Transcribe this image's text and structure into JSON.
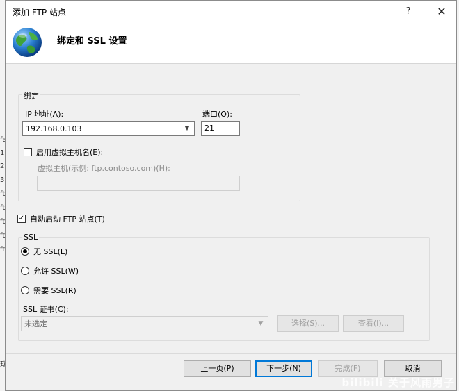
{
  "background": {
    "left_fragments": [
      "fa",
      "1",
      "2",
      "3",
      "ft",
      "ft",
      "ft",
      "ft",
      "ft",
      "现"
    ]
  },
  "dialog": {
    "title": "添加 FTP 站点",
    "help_glyph": "?",
    "close_glyph": "✕",
    "header_title": "绑定和 SSL 设置"
  },
  "binding": {
    "group_label": "绑定",
    "ip_label": "IP 地址(A):",
    "ip_value": "192.168.0.103",
    "port_label": "端口(O):",
    "port_value": "21",
    "virtual_host_checkbox_label": "启用虚拟主机名(E):",
    "virtual_host_checked": false,
    "virtual_host_label": "虚拟主机(示例: ftp.contoso.com)(H):",
    "virtual_host_value": ""
  },
  "autostart": {
    "label": "自动启动 FTP 站点(T)",
    "checked": true,
    "check_glyph": "✓"
  },
  "ssl": {
    "group_label": "SSL",
    "options": [
      {
        "label": "无 SSL(L)",
        "checked": true
      },
      {
        "label": "允许 SSL(W)",
        "checked": false
      },
      {
        "label": "需要 SSL(R)",
        "checked": false
      }
    ],
    "cert_label": "SSL 证书(C):",
    "cert_value": "未选定",
    "select_button": "选择(S)...",
    "view_button": "查看(I)..."
  },
  "footer": {
    "prev_button": "上一页(P)",
    "next_button": "下一步(N)",
    "finish_button": "完成(F)",
    "cancel_button": "取消"
  },
  "watermark": "bilibili 关于风雨男子",
  "colors": {
    "accent": "#0078d7",
    "dialog_bg": "#f0f0f0"
  }
}
